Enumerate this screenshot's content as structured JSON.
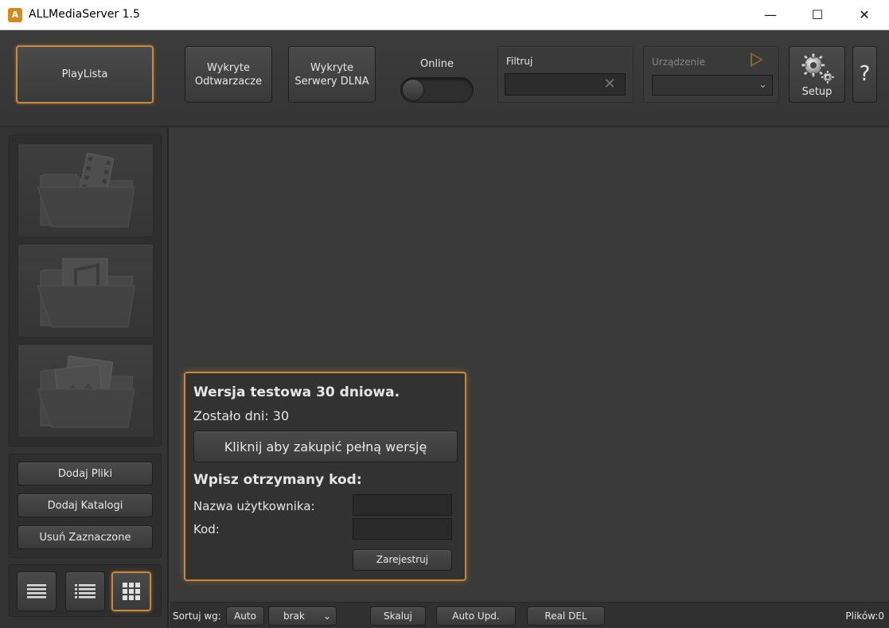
{
  "window": {
    "title": "ALLMediaServer 1.5",
    "icon_letter": "A",
    "min_glyph": "—",
    "max_glyph": "☐",
    "close_glyph": "✕"
  },
  "toolbar": {
    "playlista": "PlayLista",
    "odtwarzacze": "Wykryte Odtwarzacze",
    "serwery": "Wykryte Serwery DLNA",
    "online": "Online",
    "filtr_label": "Filtruj",
    "filtr_value": "",
    "filtr_clear": "✕",
    "urz_label": "Urządzenie",
    "urz_value": "",
    "setup": "Setup",
    "help": "?"
  },
  "sidebar": {
    "categories": [
      {
        "icon": "video-folder-icon"
      },
      {
        "icon": "music-folder-icon"
      },
      {
        "icon": "photo-folder-icon"
      }
    ],
    "actions": {
      "add_files": "Dodaj Pliki",
      "add_folders": "Dodaj Katalogi",
      "remove_selected": "Usuń Zaznaczone"
    },
    "views": [
      "list-view-icon",
      "detail-list-icon",
      "grid-view-icon"
    ]
  },
  "trial": {
    "title": "Wersja testowa 30 dniowa.",
    "days_left": "Zostało dni: 30",
    "buy": "Kliknij aby zakupić pełną wersję",
    "code_title": "Wpisz otrzymany kod:",
    "user_label": "Nazwa użytkownika:",
    "code_label": "Kod:",
    "user_value": "",
    "code_value": "",
    "register": "Zarejestruj"
  },
  "bottombar": {
    "sort_label": "Sortuj wg:",
    "auto": "Auto",
    "brak": "brak",
    "chevron": "⌄",
    "skaluj": "Skaluj",
    "auto_upd": "Auto Upd.",
    "real_del": "Real DEL",
    "files": "Plików:0"
  },
  "colors": {
    "accent": "#c8893a",
    "background": "#3a3a3a",
    "text": "#e6e6e6"
  }
}
